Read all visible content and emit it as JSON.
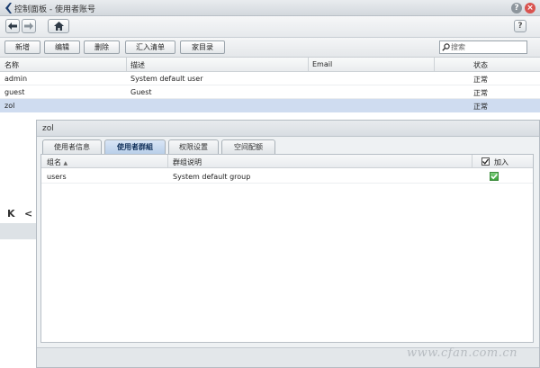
{
  "window": {
    "title": "控制面板 - 使用者账号",
    "help_glyph": "?",
    "close_glyph": "×"
  },
  "navbar": {
    "help_glyph": "?"
  },
  "toolbar": {
    "buttons": [
      "新增",
      "编辑",
      "删除",
      "汇入清单",
      "家目录"
    ],
    "search_placeholder": "搜索"
  },
  "users_table": {
    "columns": [
      "名称",
      "描述",
      "Email",
      "状态"
    ],
    "rows": [
      {
        "name": "admin",
        "description": "System default user",
        "email": "",
        "status": "正常"
      },
      {
        "name": "guest",
        "description": "Guest",
        "email": "",
        "status": "正常"
      },
      {
        "name": "zol",
        "description": "",
        "email": "",
        "status": "正常"
      }
    ]
  },
  "pager": {
    "first": "K",
    "prev": "<"
  },
  "dialog": {
    "title": "zol",
    "tabs": [
      "使用者信息",
      "使用者群組",
      "权限设置",
      "空间配额"
    ],
    "active_tab": "使用者群組",
    "groups_table": {
      "columns": [
        "组名",
        "群组说明",
        "加入"
      ],
      "sort_indicator": "▲",
      "rows": [
        {
          "group": "users",
          "description": "System default group",
          "joined": true
        }
      ]
    }
  },
  "watermark": "www.cfan.com.cn",
  "colors": {
    "selection": "#cfdcf0",
    "active_tab": "#b9cfe9",
    "close_button": "#d9534f",
    "checkbox_checked": "#3aa33a"
  }
}
